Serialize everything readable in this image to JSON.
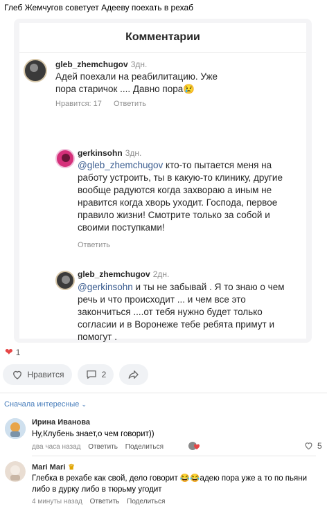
{
  "post": {
    "title": "Глеб Жемчугов советует Адееву поехать в рехаб"
  },
  "embedded": {
    "header": "Комментарии",
    "comments": [
      {
        "user": "gleb_zhemchugov",
        "time": "3дн.",
        "text": "Адей поехали на реабилитацию.  Уже пора старичок .... Давно пора😢",
        "likes": "Нравится: 17",
        "reply": "Ответить"
      },
      {
        "user": "gerkinsohn",
        "time": "3дн.",
        "mention": "@gleb_zhemchugov",
        "text": " кто-то пытается меня на работу устроить, ты в какую-то клинику, другие вообще радуются когда захвораю а иным не нравится когда хворь уходит. Господа, первое правило жизни! Смотрите только за собой и своими поступками!",
        "reply": "Ответить"
      },
      {
        "user": "gleb_zhemchugov",
        "time": "2дн.",
        "mention": "@gerkinsohn",
        "text": " и ты не забывай . Я то знаю о чем речь и что происходит ... и чем все это закончиться ....от тебя нужно будет только согласии и в Воронеже тебе ребята примут и помогут ."
      }
    ]
  },
  "reactions": {
    "like_count": "1",
    "like_label": "Нравится",
    "comment_count": "2"
  },
  "sort_label": "Сначала интересные",
  "comments": [
    {
      "name": "Ирина Иванова",
      "text": "Ну,Клубень знает,о чем говорит))",
      "time": "два часа назад",
      "reply": "Ответить",
      "share": "Поделиться",
      "like_count": "5"
    },
    {
      "name": "Mari Mari",
      "text": "Глебка в рехабе как свой, дело говорит 😂😂адею пора уже а то по пьяни либо в дурку либо в тюрьму угодит",
      "time": "4 минуты назад",
      "reply": "Ответить",
      "share": "Поделиться"
    }
  ],
  "colors": {
    "accent": "#447bba",
    "heart": "#e64646",
    "mention": "#3a5c8f"
  }
}
